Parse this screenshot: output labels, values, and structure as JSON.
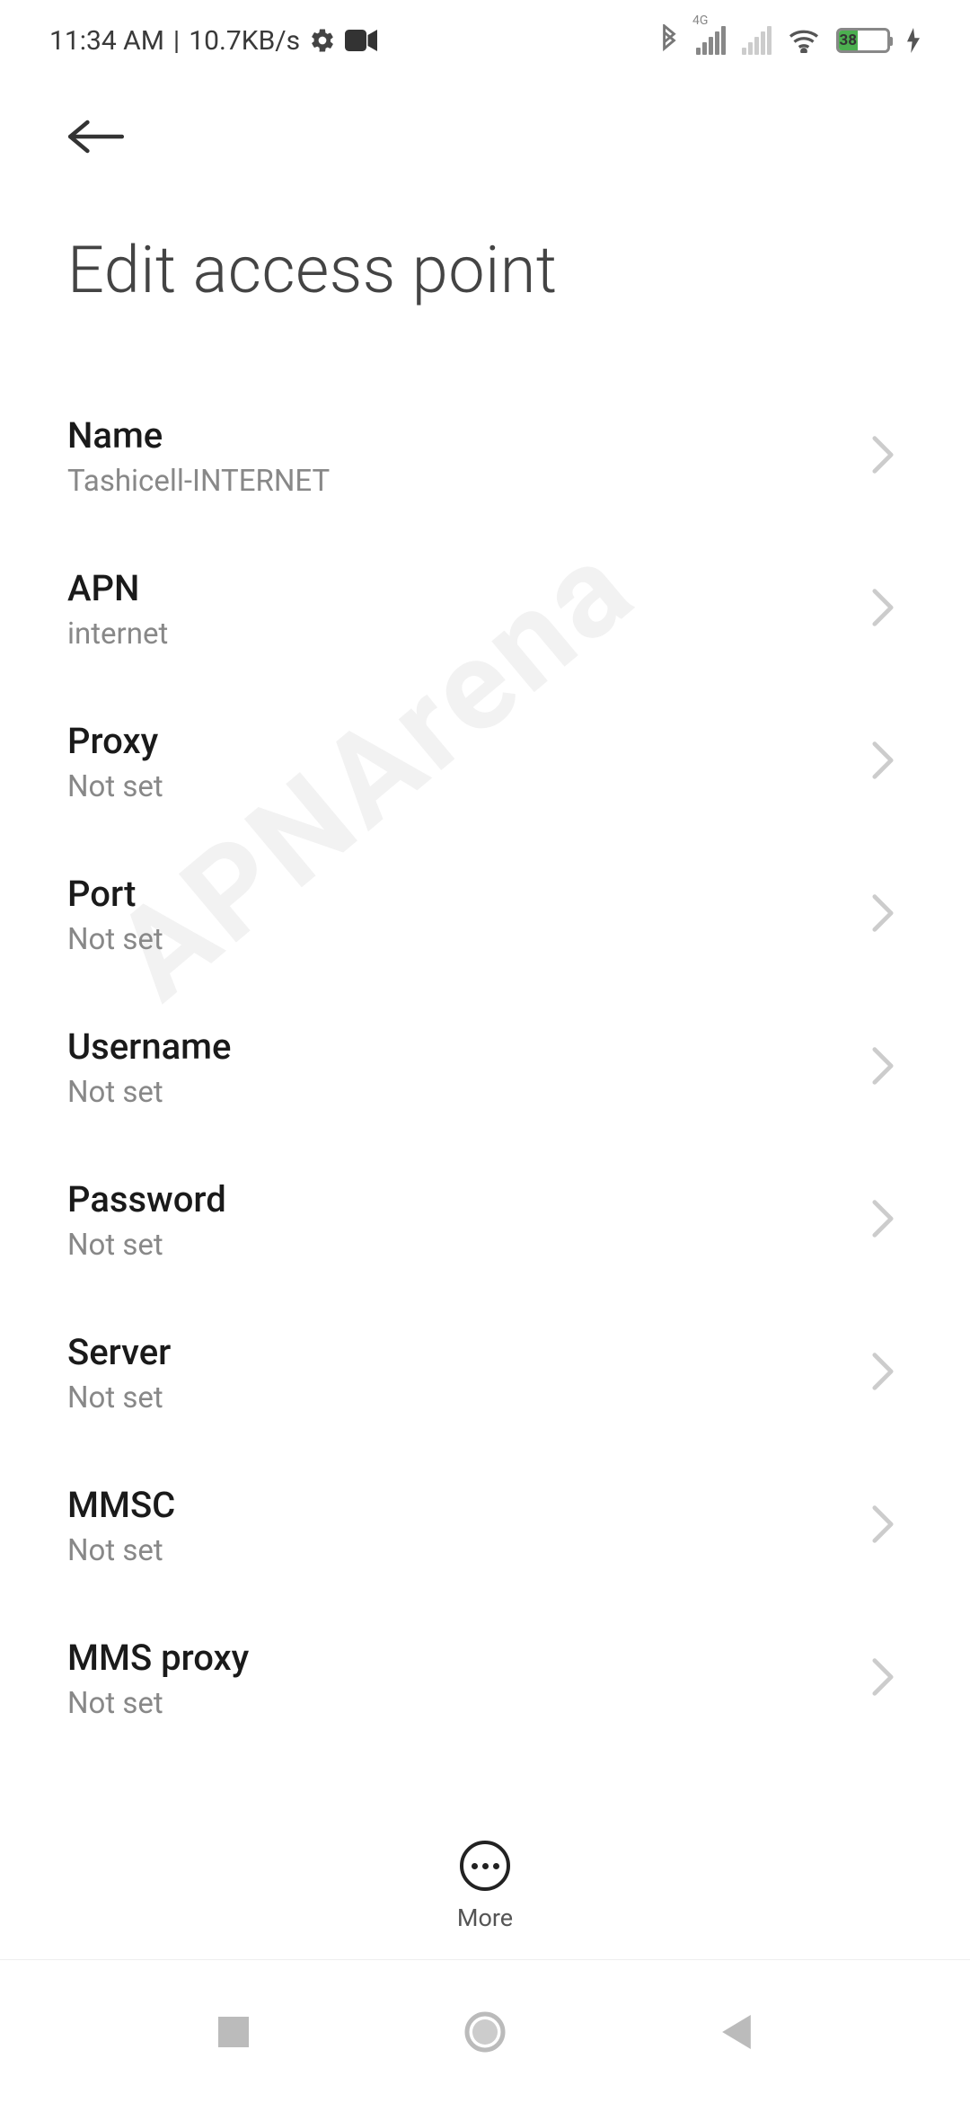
{
  "status_bar": {
    "time": "11:34 AM",
    "separator": "|",
    "net_speed": "10.7KB/s",
    "network_badge": "4G",
    "battery_pct": "38"
  },
  "page": {
    "title": "Edit access point"
  },
  "settings": [
    {
      "label": "Name",
      "value": "Tashicell-INTERNET"
    },
    {
      "label": "APN",
      "value": "internet"
    },
    {
      "label": "Proxy",
      "value": "Not set"
    },
    {
      "label": "Port",
      "value": "Not set"
    },
    {
      "label": "Username",
      "value": "Not set"
    },
    {
      "label": "Password",
      "value": "Not set"
    },
    {
      "label": "Server",
      "value": "Not set"
    },
    {
      "label": "MMSC",
      "value": "Not set"
    },
    {
      "label": "MMS proxy",
      "value": "Not set"
    }
  ],
  "bottom_action": {
    "label": "More"
  },
  "watermark": "APNArena"
}
